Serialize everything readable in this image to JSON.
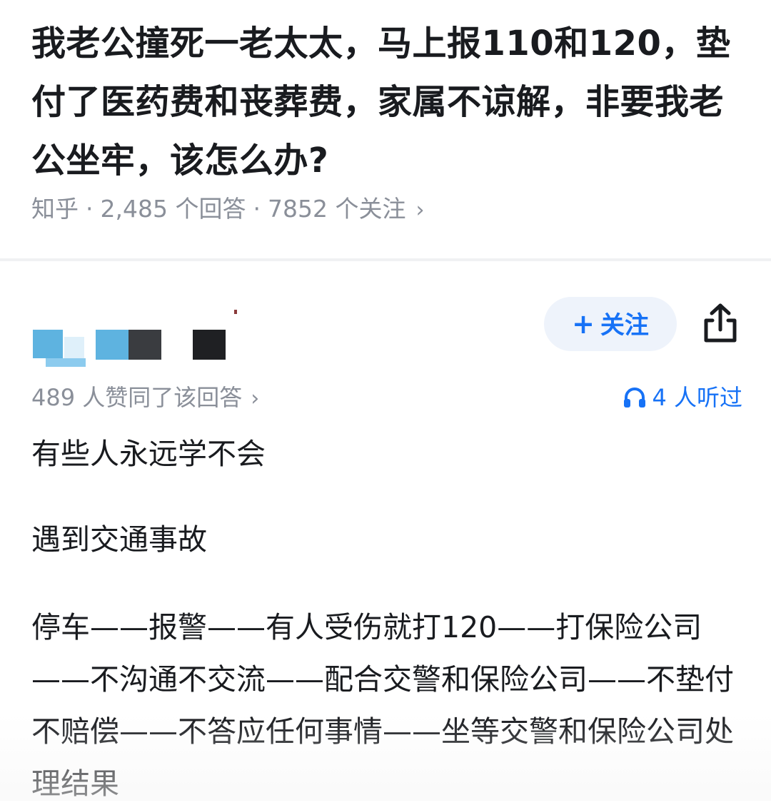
{
  "question": {
    "title": "我老公撞死一老太太，马上报110和120，垫付了医药费和丧葬费，家属不谅解，非要我老公坐牢，该怎么办?",
    "source": "知乎",
    "answers": "2,485 个回答",
    "followers": "7852 个关注"
  },
  "author": {
    "follow_label": "关注",
    "follow_icon": "plus-icon",
    "share_icon": "share-icon"
  },
  "answer": {
    "likes": "489 人赞同了该回答",
    "listens": "4 人听过",
    "accent_color": "#1772f6",
    "paragraphs": [
      "有些人永远学不会",
      "遇到交通事故",
      "停车——报警——有人受伤就打120——打保险公司——不沟通不交流——配合交警和保险公司——不垫付不赔偿——不答应任何事情——坐等交警和保险公司处理结果"
    ]
  }
}
